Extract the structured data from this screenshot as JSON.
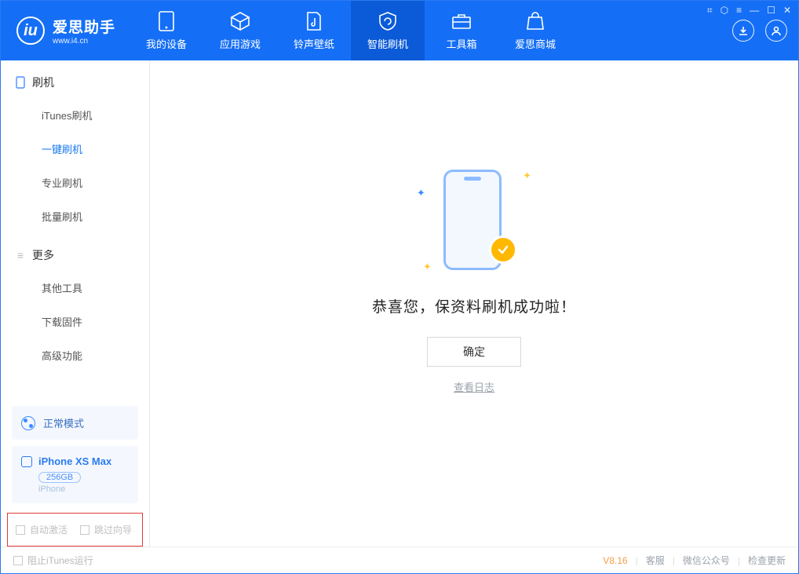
{
  "logo": {
    "cn": "爱思助手",
    "en": "www.i4.cn",
    "mark": "iu"
  },
  "tabs": [
    {
      "label": "我的设备"
    },
    {
      "label": "应用游戏"
    },
    {
      "label": "铃声壁纸"
    },
    {
      "label": "智能刷机"
    },
    {
      "label": "工具箱"
    },
    {
      "label": "爱思商城"
    }
  ],
  "sidebar": {
    "section1": {
      "title": "刷机",
      "items": [
        "iTunes刷机",
        "一键刷机",
        "专业刷机",
        "批量刷机"
      ]
    },
    "section2": {
      "title": "更多",
      "items": [
        "其他工具",
        "下载固件",
        "高级功能"
      ]
    },
    "mode": "正常模式",
    "device": {
      "name": "iPhone XS Max",
      "storage": "256GB",
      "type": "iPhone"
    },
    "opts": {
      "auto_activate": "自动激活",
      "skip_guide": "跳过向导"
    }
  },
  "main": {
    "success": "恭喜您，保资料刷机成功啦！",
    "ok": "确定",
    "view_log": "查看日志"
  },
  "footer": {
    "block_itunes": "阻止iTunes运行",
    "version": "V8.16",
    "support": "客服",
    "wechat": "微信公众号",
    "update": "检查更新"
  }
}
